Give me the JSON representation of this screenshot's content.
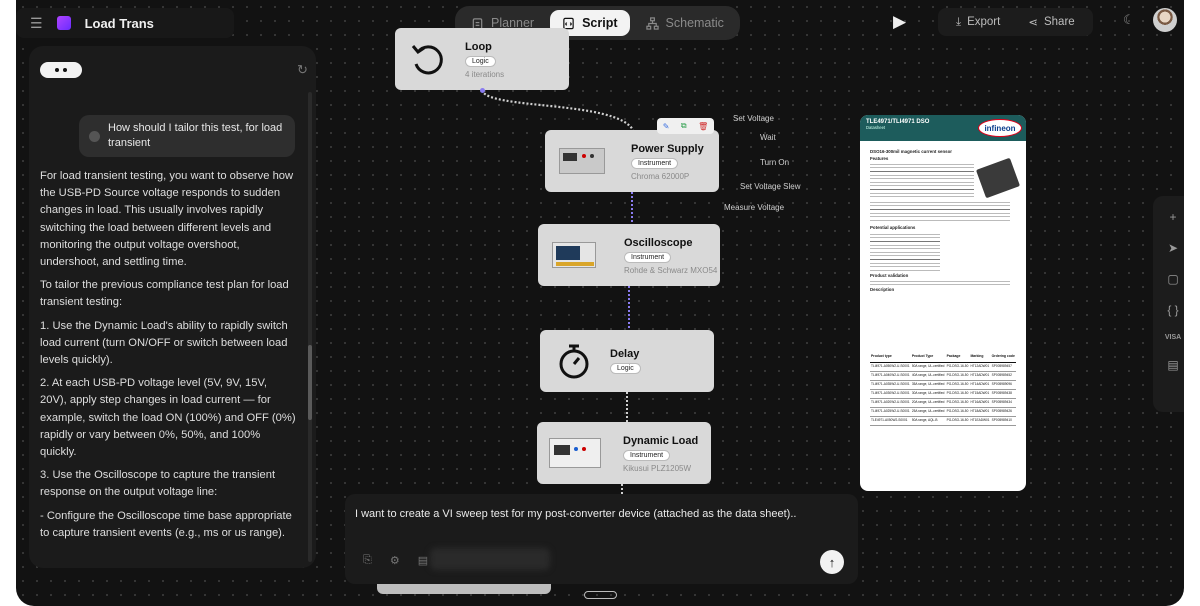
{
  "app": {
    "project_title": "Load Trans"
  },
  "mode_tabs": [
    {
      "label": "Planner",
      "icon": "clipboard-icon",
      "active": false
    },
    {
      "label": "Script",
      "icon": "script-icon",
      "active": true
    },
    {
      "label": "Schematic",
      "icon": "schematic-icon",
      "active": false
    }
  ],
  "toolbar": {
    "export_label": "Export",
    "share_label": "Share"
  },
  "chat": {
    "user_message": "How should I tailor this test, for load transient",
    "paragraphs": [
      "For load transient testing, you want to observe how the USB-PD Source voltage responds to sudden changes in load. This usually involves rapidly switching the load between different levels and monitoring the output voltage overshoot, undershoot, and settling time.",
      "To tailor the previous compliance test plan for load transient testing:",
      "1. Use the Dynamic Load's ability to rapidly switch load current (turn ON/OFF or switch between load levels quickly).",
      "2. At each USB-PD voltage level (5V, 9V, 15V, 20V), apply step changes in load current — for example, switch the load ON (100%) and OFF (0%) rapidly or vary between 0%, 50%, and 100% quickly.",
      "3. Use the Oscilloscope to capture the transient response on the output voltage line:",
      "- Configure the Oscilloscope time base appropriate to capture transient events (e.g., ms or us range)."
    ]
  },
  "nodes": {
    "loop": {
      "title": "Loop",
      "badge": "Logic",
      "sub": "4 iterations"
    },
    "power_supply": {
      "title": "Power Supply",
      "badge": "Instrument",
      "sub": "Chroma 62000P"
    },
    "oscilloscope": {
      "title": "Oscilloscope",
      "badge": "Instrument",
      "sub": "Rohde & Schwarz MXO54"
    },
    "delay": {
      "title": "Delay",
      "badge": "Logic"
    },
    "dynamic_load": {
      "title": "Dynamic Load",
      "badge": "Instrument",
      "sub": "Kikusui PLZ1205W"
    }
  },
  "edge_labels": [
    "Set Voltage",
    "Wait",
    "Turn On",
    "Set Voltage Slew",
    "Measure Voltage"
  ],
  "datasheet": {
    "title": "TLE4971/TLI4971 DSO",
    "subtitle": "Datasheet",
    "brand": "infineon",
    "product_line": "DSO16-300mil magnetic current sensor",
    "sections": {
      "features": "Features",
      "applications": "Potential applications",
      "validation": "Product validation",
      "description": "Description"
    },
    "table_headers": [
      "Product type",
      "Product Type",
      "Package",
      "Marking",
      "Ordering code"
    ],
    "table_rows": [
      [
        "TLI4971-A050W2-U-S0001",
        "50A range, UL-certified",
        "PG-DSO-16-50",
        "HT12ADW01",
        "SP005989457"
      ],
      [
        "TLI4971-A040W2-U-S0001",
        "40A range, UL-certified",
        "PG-DSO-16-50",
        "HT13ADW01",
        "SP005989452"
      ],
      [
        "TLI4971-A035W2-U-S0001",
        "35A range, UL-certified",
        "PG-DSO-16-50",
        "HT14ADW01",
        "SP005989096"
      ],
      [
        "TLI4971-A030W2-U-S0001",
        "30A range, UL-certified",
        "PG-DSO-16-50",
        "HT15ADW01",
        "SP005989438"
      ],
      [
        "TLI4971-A020W2-U-S0001",
        "20A range, UL-certified",
        "PG-DSO-16-50",
        "HT16ADW01",
        "SP005989434"
      ],
      [
        "TLI4971-A025W2-U-S0001",
        "25A range, UL-certified",
        "PG-DSO-16-50",
        "HT18ADW01",
        "SP005989426"
      ],
      [
        "TLE4971-A050W2-S0001",
        "50A range, AQL-B",
        "PG-DSO-16-50",
        "HT1EADW01",
        "SP005989410"
      ]
    ]
  },
  "prompt": {
    "text": "I want to create a VI sweep test for my post-converter device (attached as the data sheet).."
  },
  "colors": {
    "background": "#121212",
    "node": "#d9d9d9",
    "port": "#8a7cf0",
    "infineon_red": "#e2001a"
  }
}
